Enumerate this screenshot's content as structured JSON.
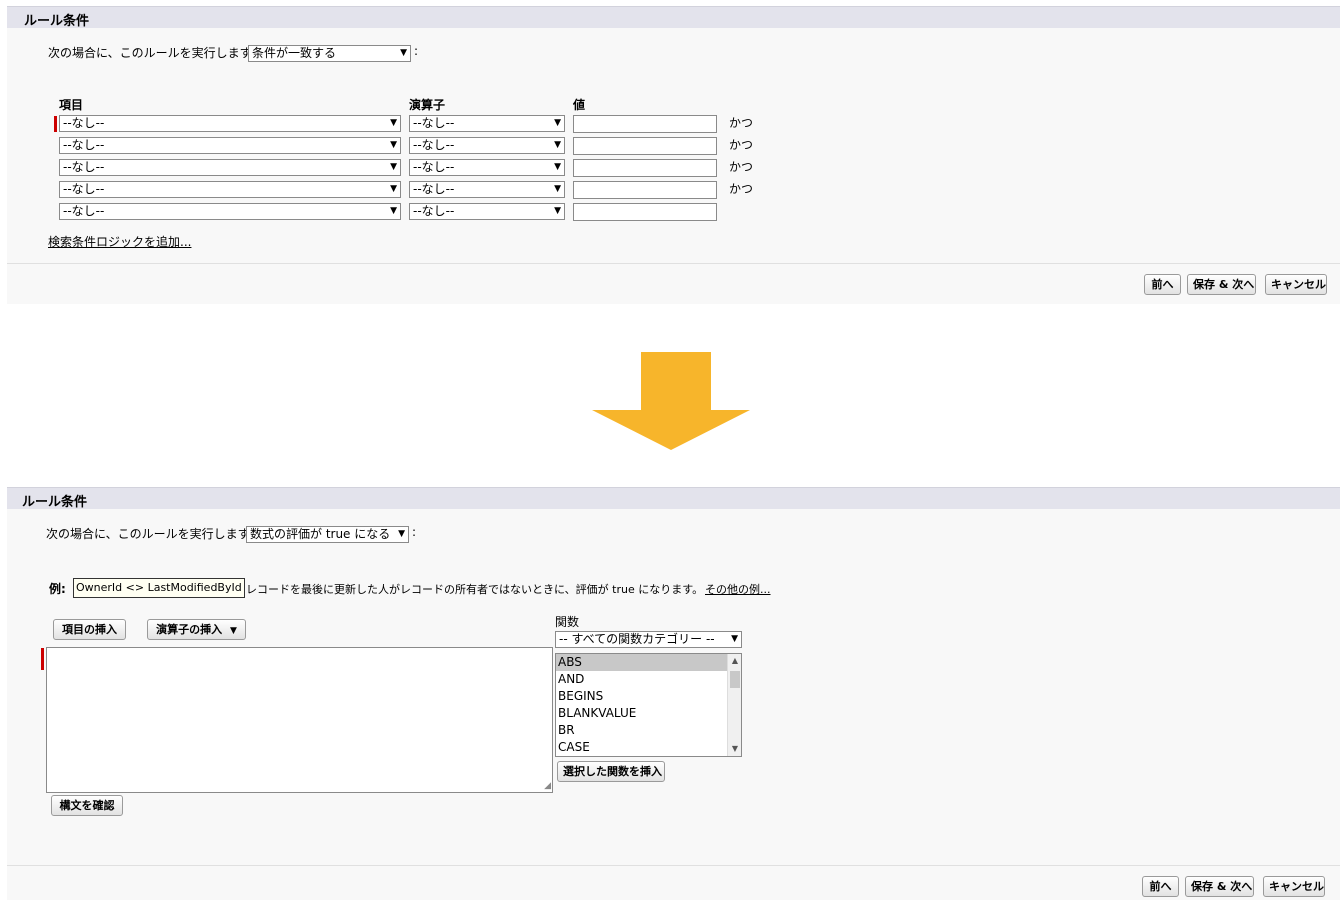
{
  "top_panel": {
    "header": "ルール条件",
    "run_prompt": "次の場合に、このルールを実行します。",
    "run_select": "条件が一致する",
    "colon": ":",
    "columns": {
      "field": "項目",
      "operator": "演算子",
      "value": "値"
    },
    "rows": [
      {
        "field": "--なし--",
        "operator": "--なし--",
        "value": "",
        "connector": "かつ"
      },
      {
        "field": "--なし--",
        "operator": "--なし--",
        "value": "",
        "connector": "かつ"
      },
      {
        "field": "--なし--",
        "operator": "--なし--",
        "value": "",
        "connector": "かつ"
      },
      {
        "field": "--なし--",
        "operator": "--なし--",
        "value": "",
        "connector": "かつ"
      },
      {
        "field": "--なし--",
        "operator": "--なし--",
        "value": "",
        "connector": ""
      }
    ],
    "add_logic_link": "検索条件ロジックを追加...",
    "buttons": {
      "prev": "前へ",
      "save_next": "保存 & 次へ",
      "cancel": "キャンセル"
    }
  },
  "arrow_color": "#f7b52b",
  "bottom_panel": {
    "header": "ルール条件",
    "run_prompt": "次の場合に、このルールを実行します。",
    "run_select": "数式の評価が true になる",
    "colon": ":",
    "example_label": "例:",
    "example_formula": "OwnerId <> LastModifiedById",
    "example_desc": "レコードを最後に更新した人がレコードの所有者ではないときに、評価が true になります。",
    "more_examples_link": "その他の例...",
    "insert_field_button": "項目の挿入",
    "insert_operator_button": "演算子の挿入",
    "formula_value": "",
    "check_syntax_button": "構文を確認",
    "functions_label": "関数",
    "function_category": "-- すべての関数カテゴリー --",
    "functions": [
      "ABS",
      "AND",
      "BEGINS",
      "BLANKVALUE",
      "BR",
      "CASE"
    ],
    "selected_function": "ABS",
    "insert_function_button": "選択した関数を挿入",
    "buttons": {
      "prev": "前へ",
      "save_next": "保存 & 次へ",
      "cancel": "キャンセル"
    }
  }
}
